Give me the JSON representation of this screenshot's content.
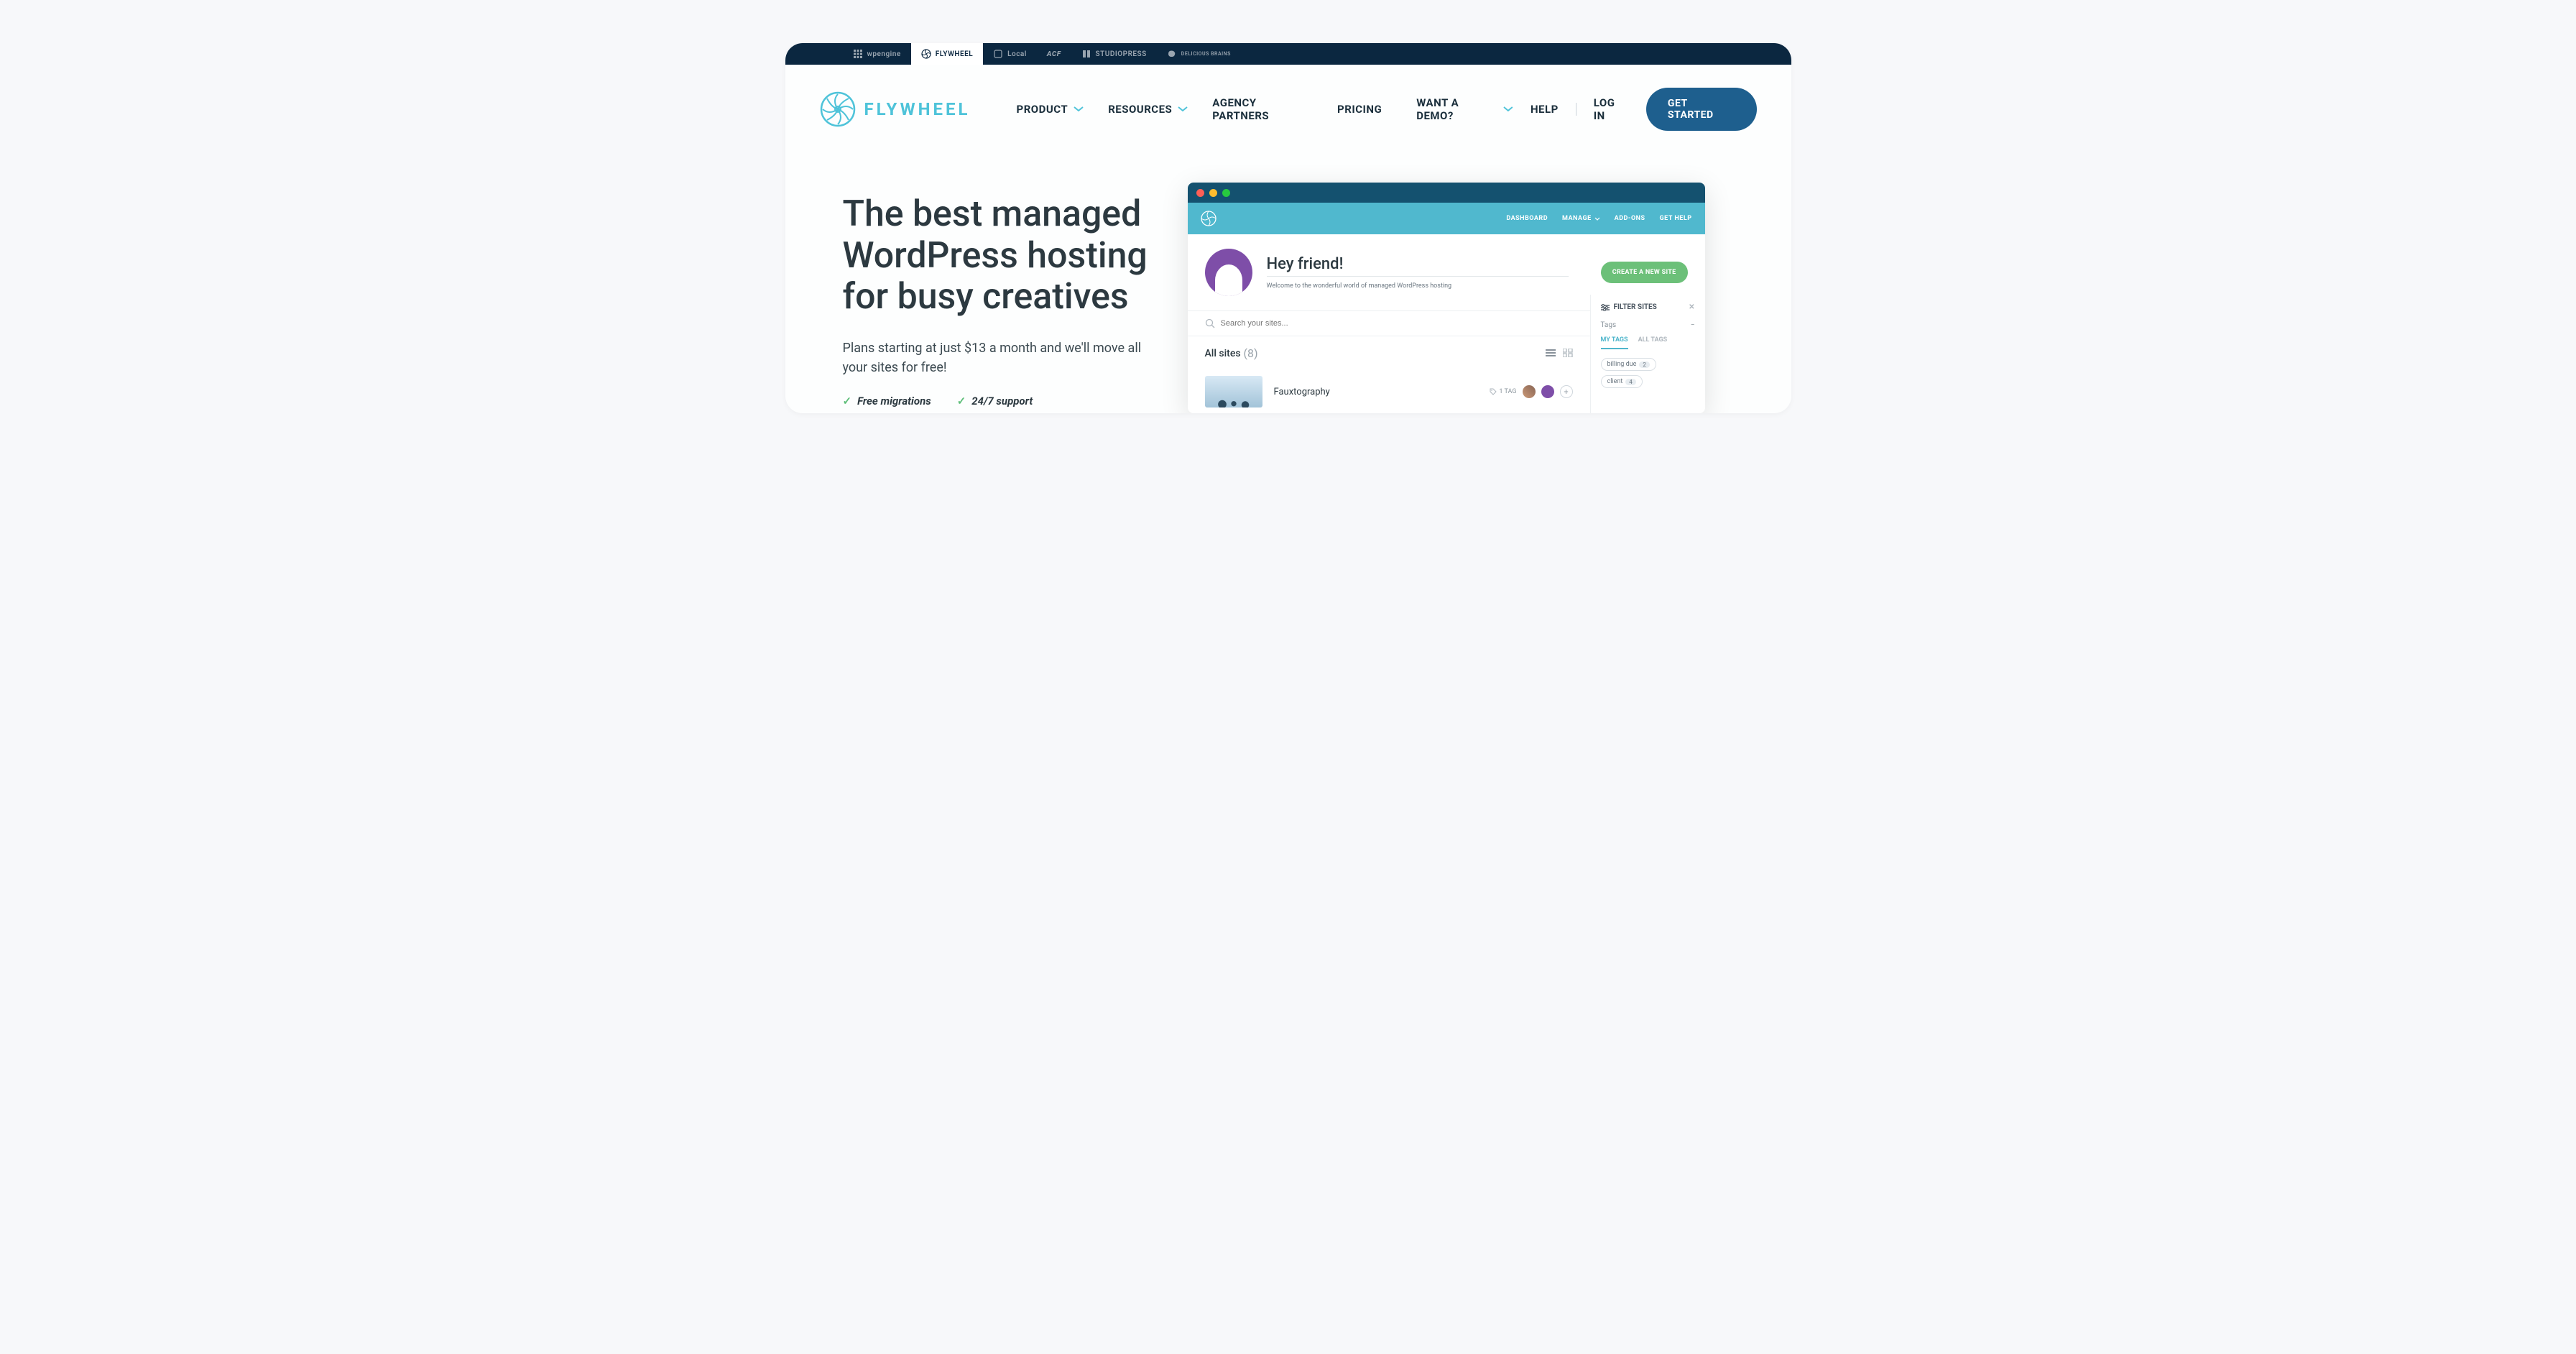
{
  "brand_bar": {
    "items": [
      {
        "label": "wpengine"
      },
      {
        "label": "FLYWHEEL"
      },
      {
        "label": "Local"
      },
      {
        "label": "ACF"
      },
      {
        "label": "STUDIOPRESS"
      },
      {
        "label": "DELICIOUS BRAINS"
      }
    ],
    "active_index": 1
  },
  "logo_text": "FLYWHEEL",
  "nav": {
    "product": "PRODUCT",
    "resources": "RESOURCES",
    "agency": "AGENCY PARTNERS",
    "pricing": "PRICING",
    "demo": "WANT A DEMO?",
    "help": "HELP",
    "login": "LOG IN",
    "cta": "GET STARTED"
  },
  "hero": {
    "title": "The best managed WordPress hosting for busy creatives",
    "subtitle": "Plans starting at just $13 a month and we'll move all your sites for free!",
    "feature1": "Free migrations",
    "feature2": "24/7 support"
  },
  "preview": {
    "nav": {
      "dashboard": "DASHBOARD",
      "manage": "MANAGE",
      "addons": "ADD-ONS",
      "help": "GET HELP"
    },
    "welcome_heading": "Hey friend!",
    "welcome_sub": "Welcome to the wonderful world of managed WordPress hosting",
    "create_btn": "CREATE A NEW SITE",
    "search_placeholder": "Search your sites...",
    "filter": {
      "title": "FILTER SITES",
      "tags_label": "Tags",
      "tab_my": "MY TAGS",
      "tab_all": "ALL TAGS",
      "pills": [
        {
          "label": "billing due",
          "count": "2"
        },
        {
          "label": "client",
          "count": "4"
        }
      ]
    },
    "sites": {
      "heading": "All sites",
      "count": "(8)"
    },
    "site_row": {
      "name": "Fauxtography",
      "tag_badge": "1 TAG"
    }
  }
}
